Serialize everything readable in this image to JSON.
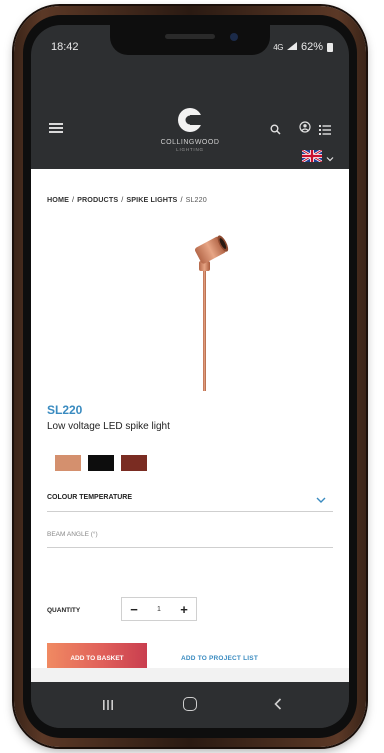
{
  "status_bar": {
    "time": "18:42",
    "network": "4G",
    "battery": "62%"
  },
  "brand": {
    "name": "COLLINGWOOD",
    "subtitle": "LIGHTING"
  },
  "breadcrumb": [
    "HOME",
    "PRODUCTS",
    "SPIKE LIGHTS",
    "SL220"
  ],
  "breadcrumb_separator": "/",
  "product": {
    "code": "SL220",
    "description": "Low voltage LED spike light",
    "swatches": [
      {
        "name": "copper",
        "color": "#d4906e"
      },
      {
        "name": "black",
        "color": "#0d0d0d"
      },
      {
        "name": "dark-brown",
        "color": "#7a2c22"
      }
    ]
  },
  "options": {
    "colour_temperature_label": "COLOUR TEMPERATURE",
    "beam_angle_placeholder": "BEAM ANGLE (°)"
  },
  "quantity": {
    "label": "QUANTITY",
    "value": "1",
    "minus": "−",
    "plus": "+"
  },
  "actions": {
    "add_to_basket": "ADD TO BASKET",
    "add_to_project_list": "ADD TO PROJECT LIST"
  },
  "colors": {
    "accent_blue": "#3a8bc0",
    "header_bg": "#2d2f31",
    "cta_start": "#f08a62",
    "cta_end": "#c93e4f"
  }
}
